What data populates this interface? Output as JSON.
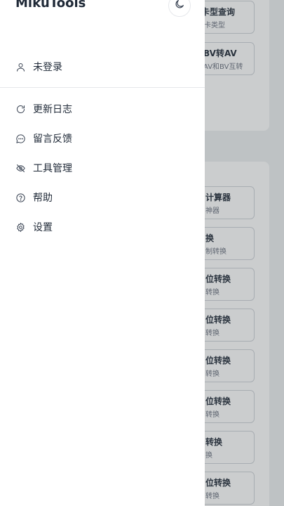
{
  "app": {
    "title": "MikuTools"
  },
  "background": {
    "cards": [
      {
        "title": "卡型查询",
        "subtitle": "卡类型"
      },
      {
        "title": "BV转AV",
        "subtitle": "AV和BV互转"
      },
      {
        "title": "计算器",
        "subtitle": "神器"
      },
      {
        "title": "换",
        "subtitle": "制转换"
      },
      {
        "title": "位转换",
        "subtitle": "转换"
      },
      {
        "title": "位转换",
        "subtitle": "转换"
      },
      {
        "title": "位转换",
        "subtitle": "转换"
      },
      {
        "title": "位转换",
        "subtitle": "转换"
      },
      {
        "title": "转换",
        "subtitle": "换"
      },
      {
        "title": "位转换",
        "subtitle": "转换"
      }
    ]
  },
  "drawer": {
    "login": {
      "label": "未登录",
      "icon": "user-icon"
    },
    "menu": [
      {
        "label": "更新日志",
        "icon": "refresh-icon"
      },
      {
        "label": "留言反馈",
        "icon": "chat-icon"
      },
      {
        "label": "工具管理",
        "icon": "eye-off-icon"
      },
      {
        "label": "帮助",
        "icon": "help-icon"
      },
      {
        "label": "设置",
        "icon": "gear-icon"
      }
    ]
  }
}
